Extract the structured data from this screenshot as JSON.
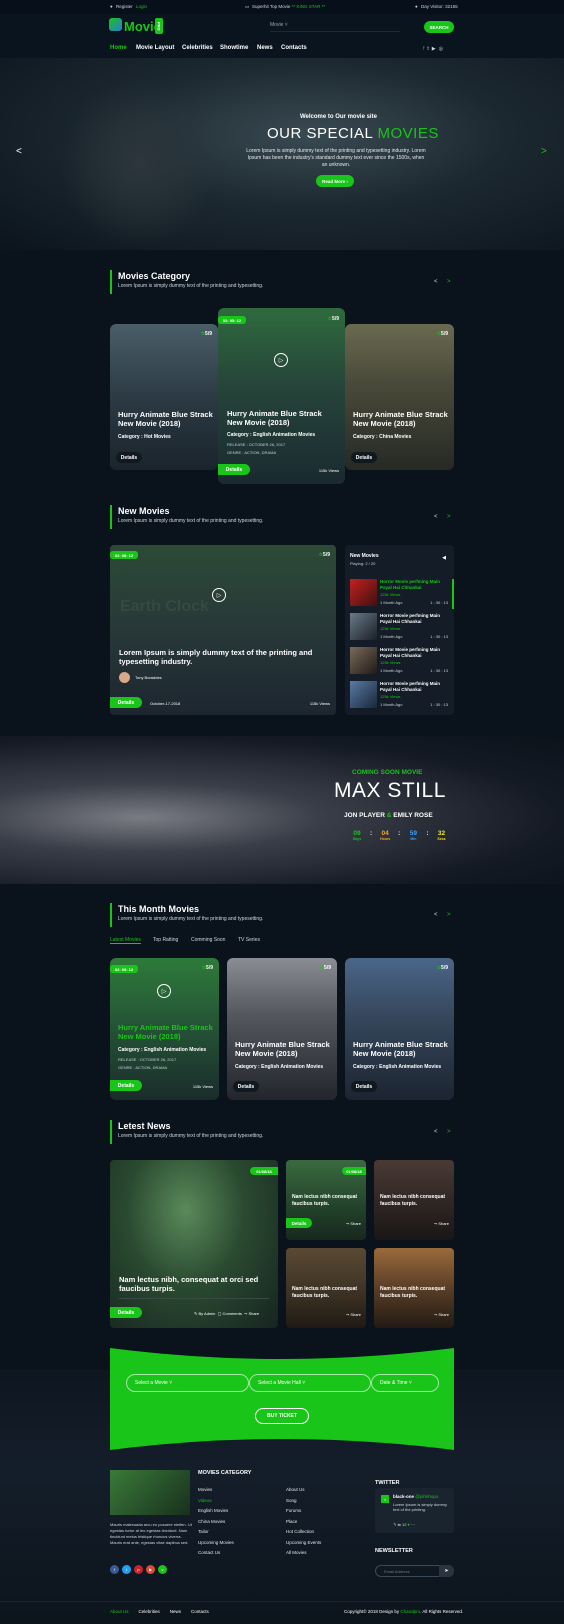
{
  "topbar": {
    "register": "Register",
    "login": "Login",
    "promo": "Superhit Top Movie ",
    "promo_highlight": "** KING STAR **",
    "visitor": "Day Visitor: 32155"
  },
  "header": {
    "logo_text": "Movie",
    "logo_badge": "PRO",
    "search_dropdown": "Movie",
    "search_button": "SEARCH"
  },
  "nav": [
    "Home",
    "Movie Layout",
    "Celebrities",
    "Showtime",
    "News",
    "Contacts"
  ],
  "hero": {
    "kicker": "Welcome to Our movie site",
    "title_white": "OUR SPECIAL ",
    "title_green": "MOVIES",
    "text": "Lorem Ipsum is simply dummy text of the printing and typesetting industry. Lorem Ipsum has been the industry's standard dummy text ever since the 1500s, when an unknown.",
    "button": "Read More"
  },
  "category": {
    "title": "Movies Category",
    "sub": "Lorem Ipsum is simply dummy text of the printing and typesetting.",
    "cards": [
      {
        "title": "Hurry Animate Blue Strack New Movie (2018)",
        "cat": "Category : Hot Movies",
        "rate": "5/9",
        "btn": "Details"
      },
      {
        "title": "Hurry Animate Blue Strack New Movie (2018)",
        "cat": "Category : English Animation Movies",
        "rate": "5/9",
        "btn": "Details",
        "time": "02: 05: 12",
        "release": "RELEASE : OCTOBER 26, 2017",
        "genre": "GENRE : ACTION, DRAMA",
        "views": "115k Views"
      },
      {
        "title": "Hurry Animate Blue Strack New Movie (2018)",
        "cat": "Category : China Movies",
        "rate": "5/9",
        "btn": "Details"
      }
    ]
  },
  "newmovies": {
    "title": "New Movies",
    "sub": "Lorem Ipsum is simply dummy text of the printing and typesetting.",
    "feature": {
      "time": "02: 08: 12",
      "rate": "5/9",
      "poster_text": "Earth Clock",
      "title": "Lorem Ipsum is simply dummy text of the printing and typesetting industry.",
      "author": "Tony Boraddes",
      "btn": "Details",
      "date": "October-17-2018",
      "views": "115k Views"
    },
    "list_title": "New Movies",
    "playing": "Playing: 2 / 20",
    "list": [
      {
        "title": "Horror Movie perfming Main Payal Hai Chhankai",
        "views": "125k Views",
        "ago": "1 Month Ago",
        "dur": "1 : 30 : 13"
      },
      {
        "title": "Horror Movie perfming Main Payal Hai Chhankai",
        "views": "125k Views",
        "ago": "1 Month Ago",
        "dur": "1 : 30 : 13"
      },
      {
        "title": "Horror Movie perfming Main Payal Hai Chhankai",
        "views": "125k Views",
        "ago": "1 Month Ago",
        "dur": "1 : 30 : 13"
      },
      {
        "title": "Horror Movie perfming Main Payal Hai Chhankai",
        "views": "125k Views",
        "ago": "1 Month Ago",
        "dur": "1 : 30 : 13"
      }
    ]
  },
  "coming": {
    "kicker": "COMING SOON MOVIE",
    "title": "MAX STILL",
    "cast_a": "JON PLAYER",
    "amp": "&",
    "cast_b": "EMILY ROSE",
    "countdown": [
      {
        "v": "09",
        "l": "Days",
        "c": "#19c519"
      },
      {
        "v": "04",
        "l": "Hours",
        "c": "#f5a623"
      },
      {
        "v": "59",
        "l": "Min",
        "c": "#3aa0ff"
      },
      {
        "v": "32",
        "l": "Secs",
        "c": "#f5e623"
      }
    ]
  },
  "month": {
    "title": "This Month Movies",
    "sub": "Lorem Ipsum is simply dummy text of the printing and typesetting.",
    "tabs": [
      "Latest Movies",
      "Top Ratting",
      "Comming Soon",
      "TV Series"
    ],
    "cards": [
      {
        "title": "Hurry Animate Blue Strack New Movie (2018)",
        "cat": "Category : English Animation Movies",
        "rate": "5/9",
        "btn": "Details",
        "time": "02: 05: 12",
        "release": "RELEASE : OCTOBER 26, 2017",
        "genre": "GENRE : ACTION, DRAMA",
        "views": "115k Views"
      },
      {
        "title": "Hurry Animate Blue Strack New Movie (2018)",
        "cat": "Category : English Animation Movies",
        "rate": "5/9",
        "btn": "Details"
      },
      {
        "title": "Hurry Animate Blue Strack New Movie (2018)",
        "cat": "Category : English Animation Movies",
        "rate": "5/9",
        "btn": "Details"
      }
    ]
  },
  "news": {
    "title": "Letest News",
    "sub": "Lorem Ipsum is simply dummy text of the printing and typesetting.",
    "big": {
      "date": "01/08/18",
      "title": "Nam lectus nibh, consequat at orci sed faucibus turpis.",
      "btn": "Details",
      "by": "By Admin",
      "comments": "Comments",
      "share": "Share"
    },
    "small": [
      {
        "date": "01/08/18",
        "title": "Nam lectus nibh consequat faucibus turpis.",
        "btn": "Details",
        "share": "Share"
      },
      {
        "title": "Nam lectus nibh consequat faucibus turpis.",
        "share": "Share"
      },
      {
        "title": "Nam lectus nibh consequat faucibus turpis.",
        "share": "Share"
      },
      {
        "title": "Nam lectus nibh consequat faucibus turpis.",
        "share": "Share"
      }
    ]
  },
  "ticket": {
    "select_movie": "Select a Movie",
    "select_hall": "Select a Movie Hall",
    "date_time": "Date & Time",
    "button": "BUY TICKET"
  },
  "footer": {
    "about": "Mauris malesuada arcu eu posuere eleifen. Ut egestas tortor at leo egestas tincidunt. Nam tincidunt metus tristique rhoncus viverra. Mauris erat ante, egestas vitae dapibus sed.",
    "cat_title": "MOVIES CATEGORY",
    "col1": [
      "Movies",
      "Videos",
      "English Movies",
      "China Movies",
      "Tailor",
      "Upcoming Movies",
      "Contact Us"
    ],
    "col2": [
      "About Us",
      "Song",
      "Forums",
      "Place",
      "Hot Collection",
      "Upcoming Events",
      "All Movies"
    ],
    "twitter_title": "TWITTER",
    "tw_user": "black-one",
    "tw_handle": "@johnhopo",
    "tw_text": "Lorem Ipsum is simply dummy text of the printing.",
    "tw_likes": "12",
    "news_title": "NEWSLETTER",
    "email_placeholder": "Email Address",
    "bottom_links": [
      "About Us",
      "Celebrities",
      "News",
      "Contacts"
    ],
    "copyright": "Copyright© 2018 Design by ",
    "copyright_brand": "Chandpro",
    "copyright_end": ". All Rights Reserved."
  },
  "colors": {
    "accent": "#19c519",
    "bg": "#0a121c"
  }
}
